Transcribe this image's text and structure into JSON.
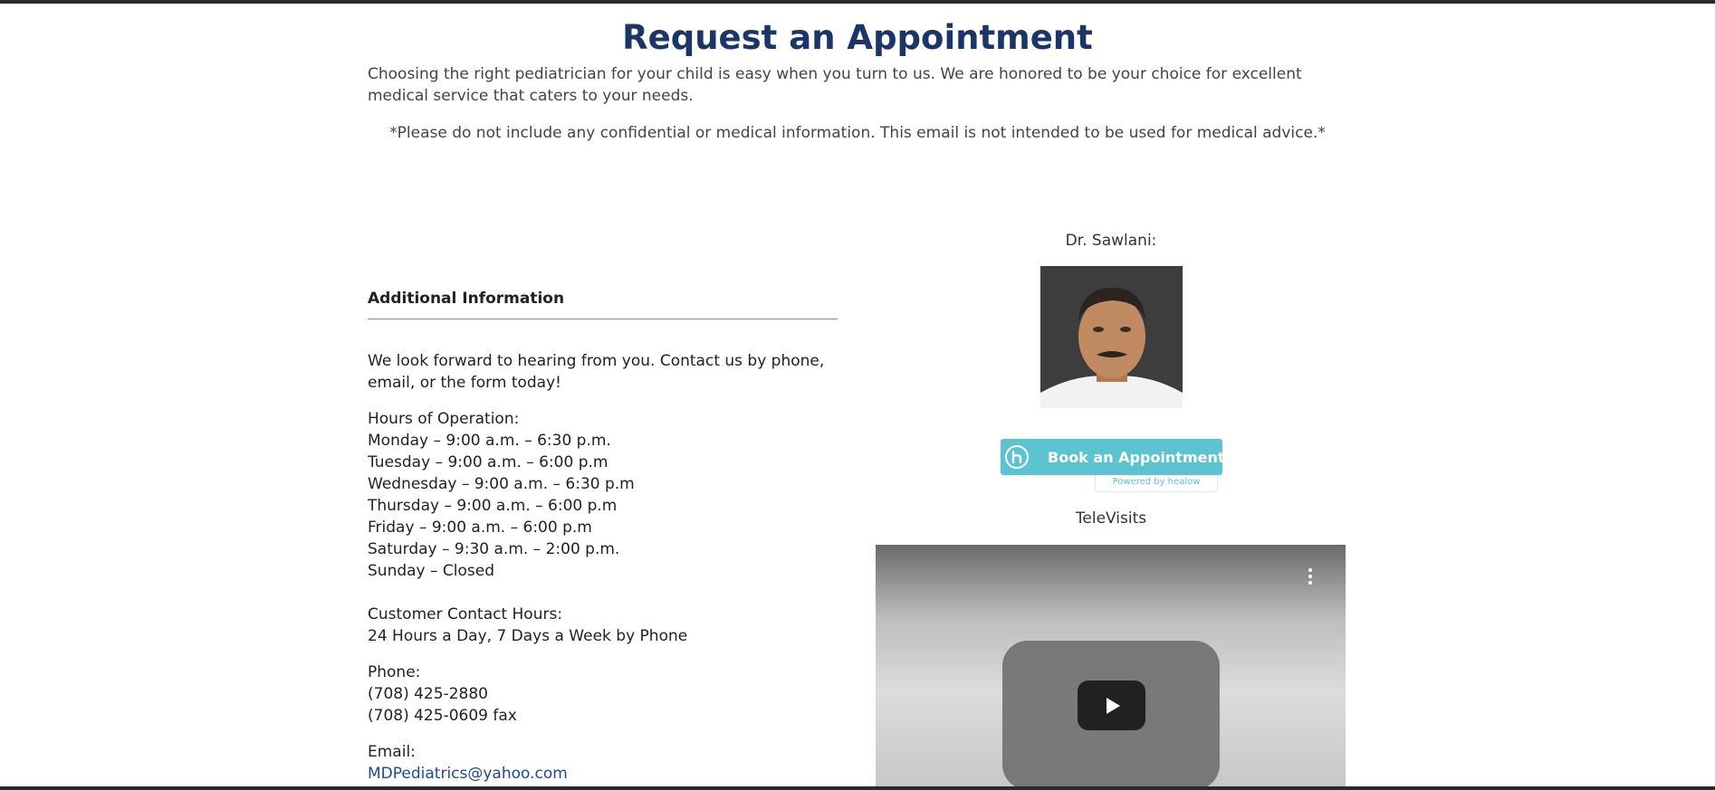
{
  "page": {
    "title": "Request an Appointment",
    "intro": "Choosing the right pediatrician for your child is easy when you turn to us. We are honored to be your choice for excellent medical service that caters to your needs.",
    "disclaimer": "*Please do not include any confidential or medical information. This email is not intended to be used for medical advice.*"
  },
  "info": {
    "heading": "Additional Information",
    "lead": "We look forward to hearing from you. Contact us by phone, email, or the form today!",
    "hours_title": "Hours of Operation:",
    "hours": [
      "Monday – 9:00 a.m. – 6:30 p.m.",
      "Tuesday – 9:00 a.m. – 6:00 p.m",
      "Wednesday – 9:00 a.m. – 6:30 p.m",
      "Thursday – 9:00 a.m. – 6:00 p.m",
      "Friday – 9:00 a.m. – 6:00 p.m",
      "Saturday – 9:30 a.m. – 2:00 p.m.",
      "Sunday – Closed"
    ],
    "contact_hours_title": "Customer Contact Hours:",
    "contact_hours": "24 Hours a Day, 7 Days a Week by Phone",
    "phone_title": "Phone:",
    "phone": "(708) 425-2880",
    "fax": "(708) 425-0609 fax",
    "email_title": "Email:",
    "email": "MDPediatrics@yahoo.com"
  },
  "doctor": {
    "label": "Dr. Sawlani:",
    "photo_icon": "doctor-portrait"
  },
  "booking": {
    "button_label": "Book an Appointment",
    "powered_by": "Powered by healow",
    "accent_color": "#5cc3d1"
  },
  "televisits": {
    "label": "TeleVisits",
    "play_icon": "play-icon",
    "menu_icon": "kebab-menu-icon"
  }
}
